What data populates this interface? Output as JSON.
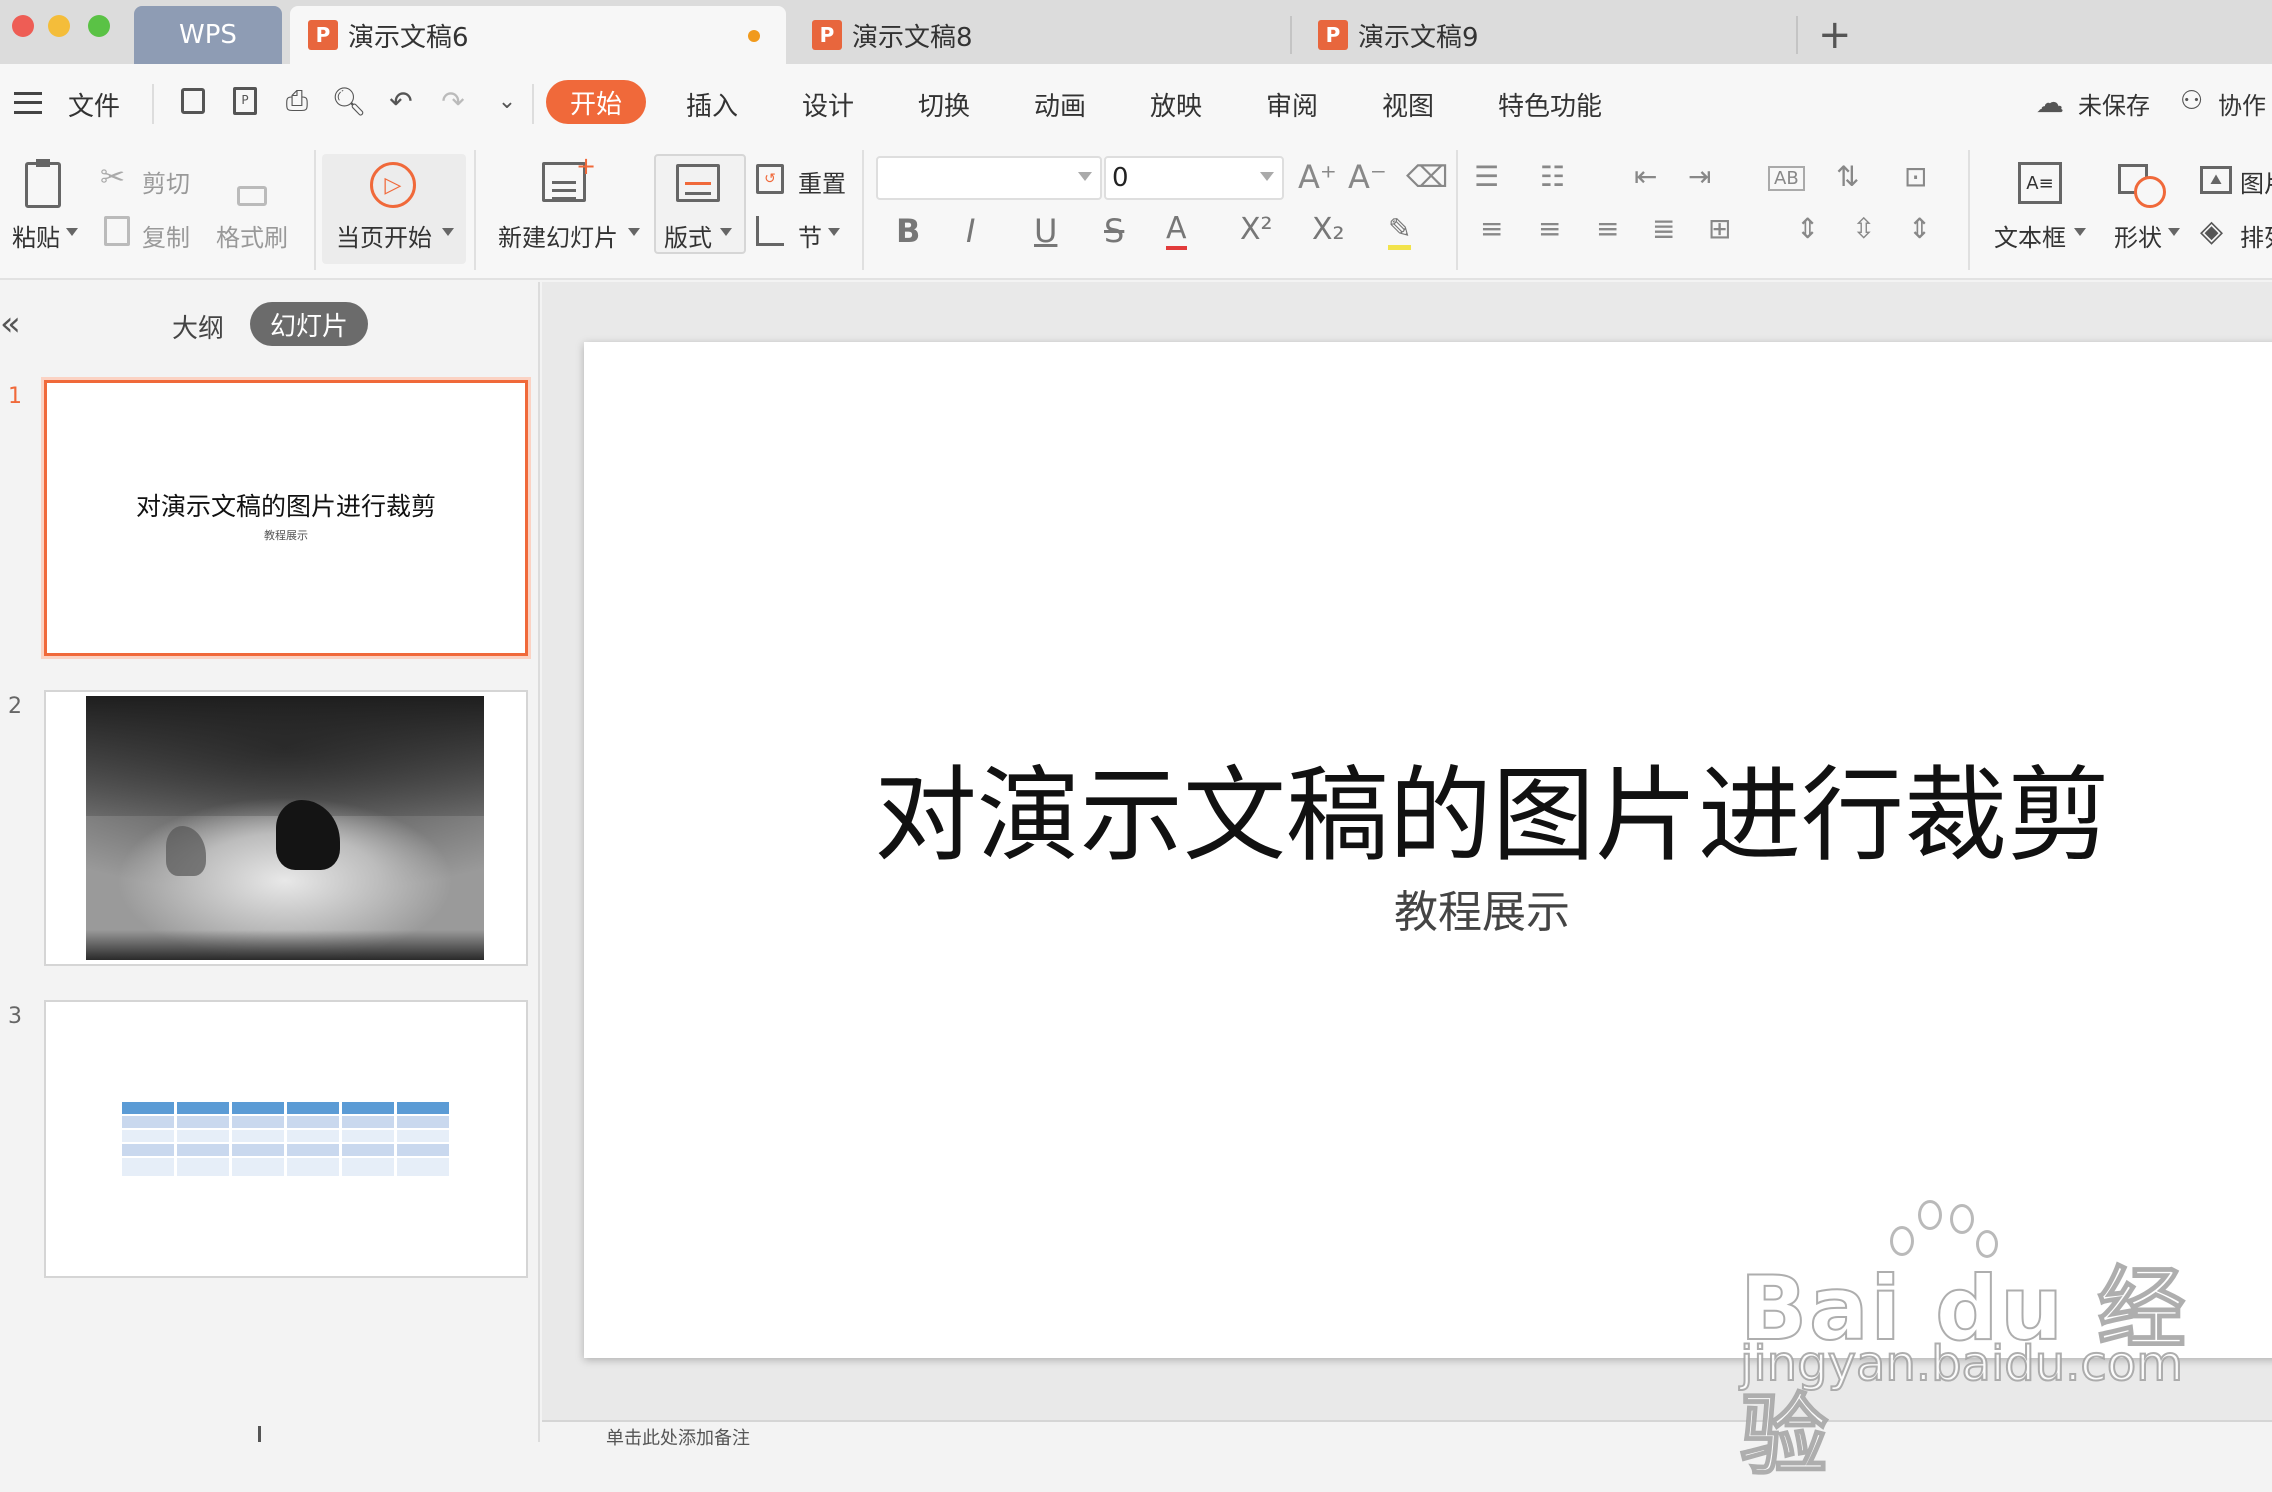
{
  "tabs": {
    "wps": "WPS",
    "doc6": "演示文稿6",
    "doc8": "演示文稿8",
    "doc9": "演示文稿9",
    "new_tab": "+"
  },
  "menu": {
    "file": "文件",
    "start": "开始",
    "insert": "插入",
    "design": "设计",
    "switch": "切换",
    "animation": "动画",
    "slideshow": "放映",
    "review": "审阅",
    "view": "视图",
    "special": "特色功能",
    "unsaved": "未保存",
    "collab": "协作"
  },
  "ribbon": {
    "paste": "粘贴",
    "cut": "剪切",
    "copy": "复制",
    "format_painter": "格式刷",
    "play_current": "当页开始",
    "new_slide": "新建幻灯片",
    "layout": "版式",
    "reset": "重置",
    "section": "节",
    "font_size": "0",
    "textbox": "文本框",
    "shape": "形状",
    "picture": "图片",
    "arrange": "排列"
  },
  "panel": {
    "outline": "大纲",
    "slides": "幻灯片",
    "collapse": "«"
  },
  "thumbs": [
    {
      "num": "1",
      "title": "对演示文稿的图片进行裁剪",
      "subtitle": "教程展示"
    },
    {
      "num": "2"
    },
    {
      "num": "3"
    }
  ],
  "slide": {
    "title": "对演示文稿的图片进行裁剪",
    "subtitle": "教程展示"
  },
  "notes": {
    "placeholder": "单击此处添加备注"
  },
  "watermark": {
    "logo": "Bai du 经验",
    "url": "jingyan.baidu.com"
  },
  "colors": {
    "accent": "#f0693a",
    "tab_wps": "#8e9cb4",
    "table_header": "#5b9bd5",
    "table_row": "#dbe5f3"
  }
}
